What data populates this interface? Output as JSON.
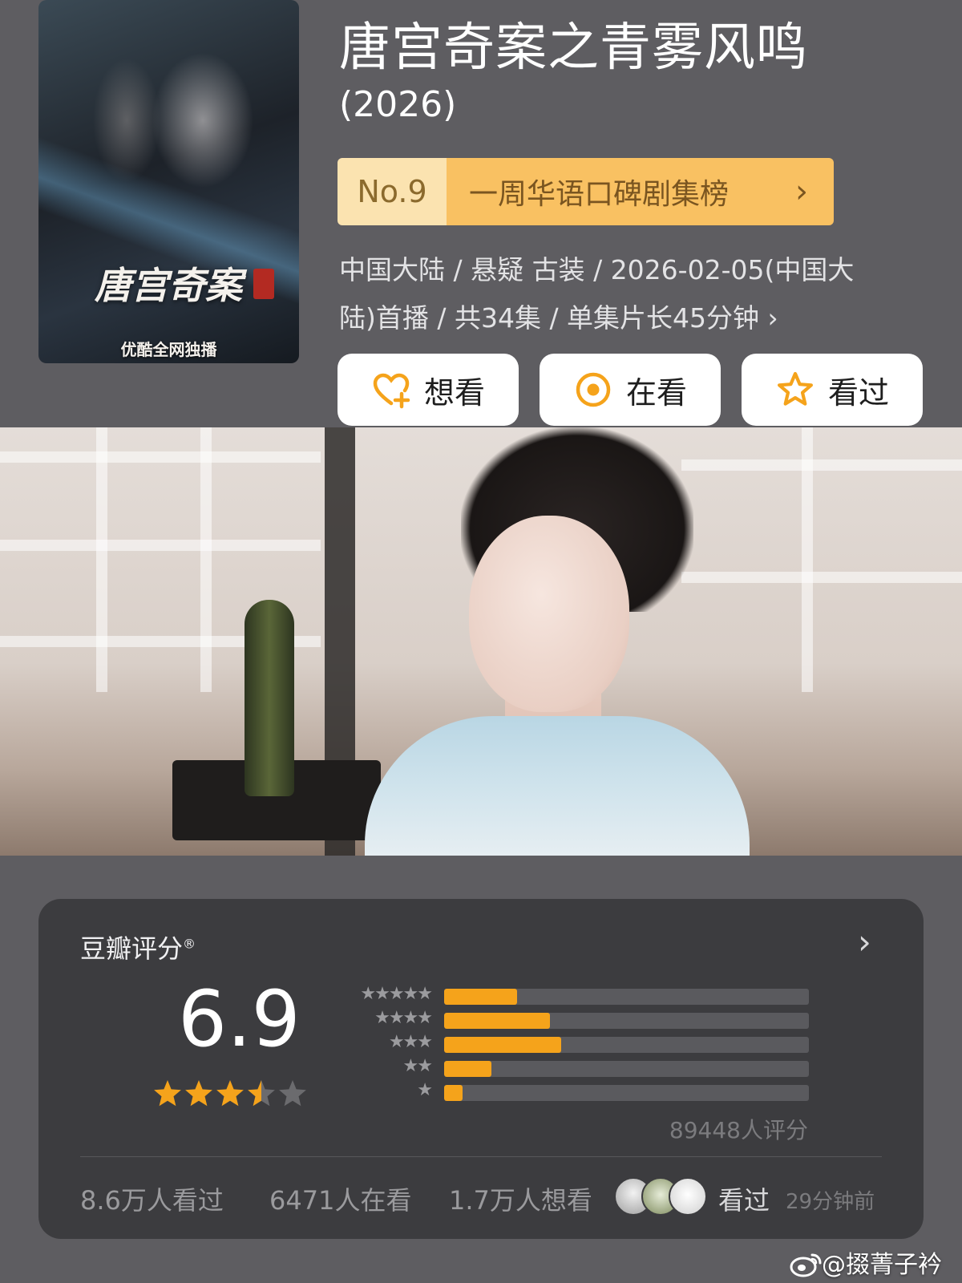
{
  "poster": {
    "title": "唐宫奇案",
    "caption": "优酷全网独播"
  },
  "title": "唐宫奇案之青雾风鸣",
  "year": "(2026)",
  "rank": {
    "number": "No.9",
    "label": "一周华语口碑剧集榜",
    "chevron": "›"
  },
  "meta": {
    "line1": "中国大陆 / 悬疑 古装 / 2026-02-05(中国大",
    "line2": "陆)首播 / 共34集 / 单集片长45分钟 ›"
  },
  "actions": [
    {
      "label": "想看",
      "icon": "heart-plus-icon"
    },
    {
      "label": "在看",
      "icon": "target-circle-icon"
    },
    {
      "label": "看过",
      "icon": "star-outline-icon"
    }
  ],
  "rating": {
    "label": "豆瓣评分",
    "registered_mark": "®",
    "chevron": "›",
    "score": "6.9",
    "stars": 3.5,
    "distribution": [
      {
        "stars": "★★★★★",
        "fraction": 0.2
      },
      {
        "stars": "★★★★",
        "fraction": 0.29
      },
      {
        "stars": "★★★",
        "fraction": 0.32
      },
      {
        "stars": "★★",
        "fraction": 0.13
      },
      {
        "stars": "★",
        "fraction": 0.05
      }
    ],
    "count": "89448人评分"
  },
  "stats": {
    "watched": "8.6万人看过",
    "watching": "6471人在看",
    "want": "1.7万人想看"
  },
  "friends": {
    "action": "看过",
    "time": "29分钟前"
  },
  "watermark": "@掇菁子衿",
  "colors": {
    "accent": "#f5a31b",
    "rank_bg": "#f9c162",
    "card_bg": "#3c3c3f",
    "page_bg": "#5e5d61"
  }
}
